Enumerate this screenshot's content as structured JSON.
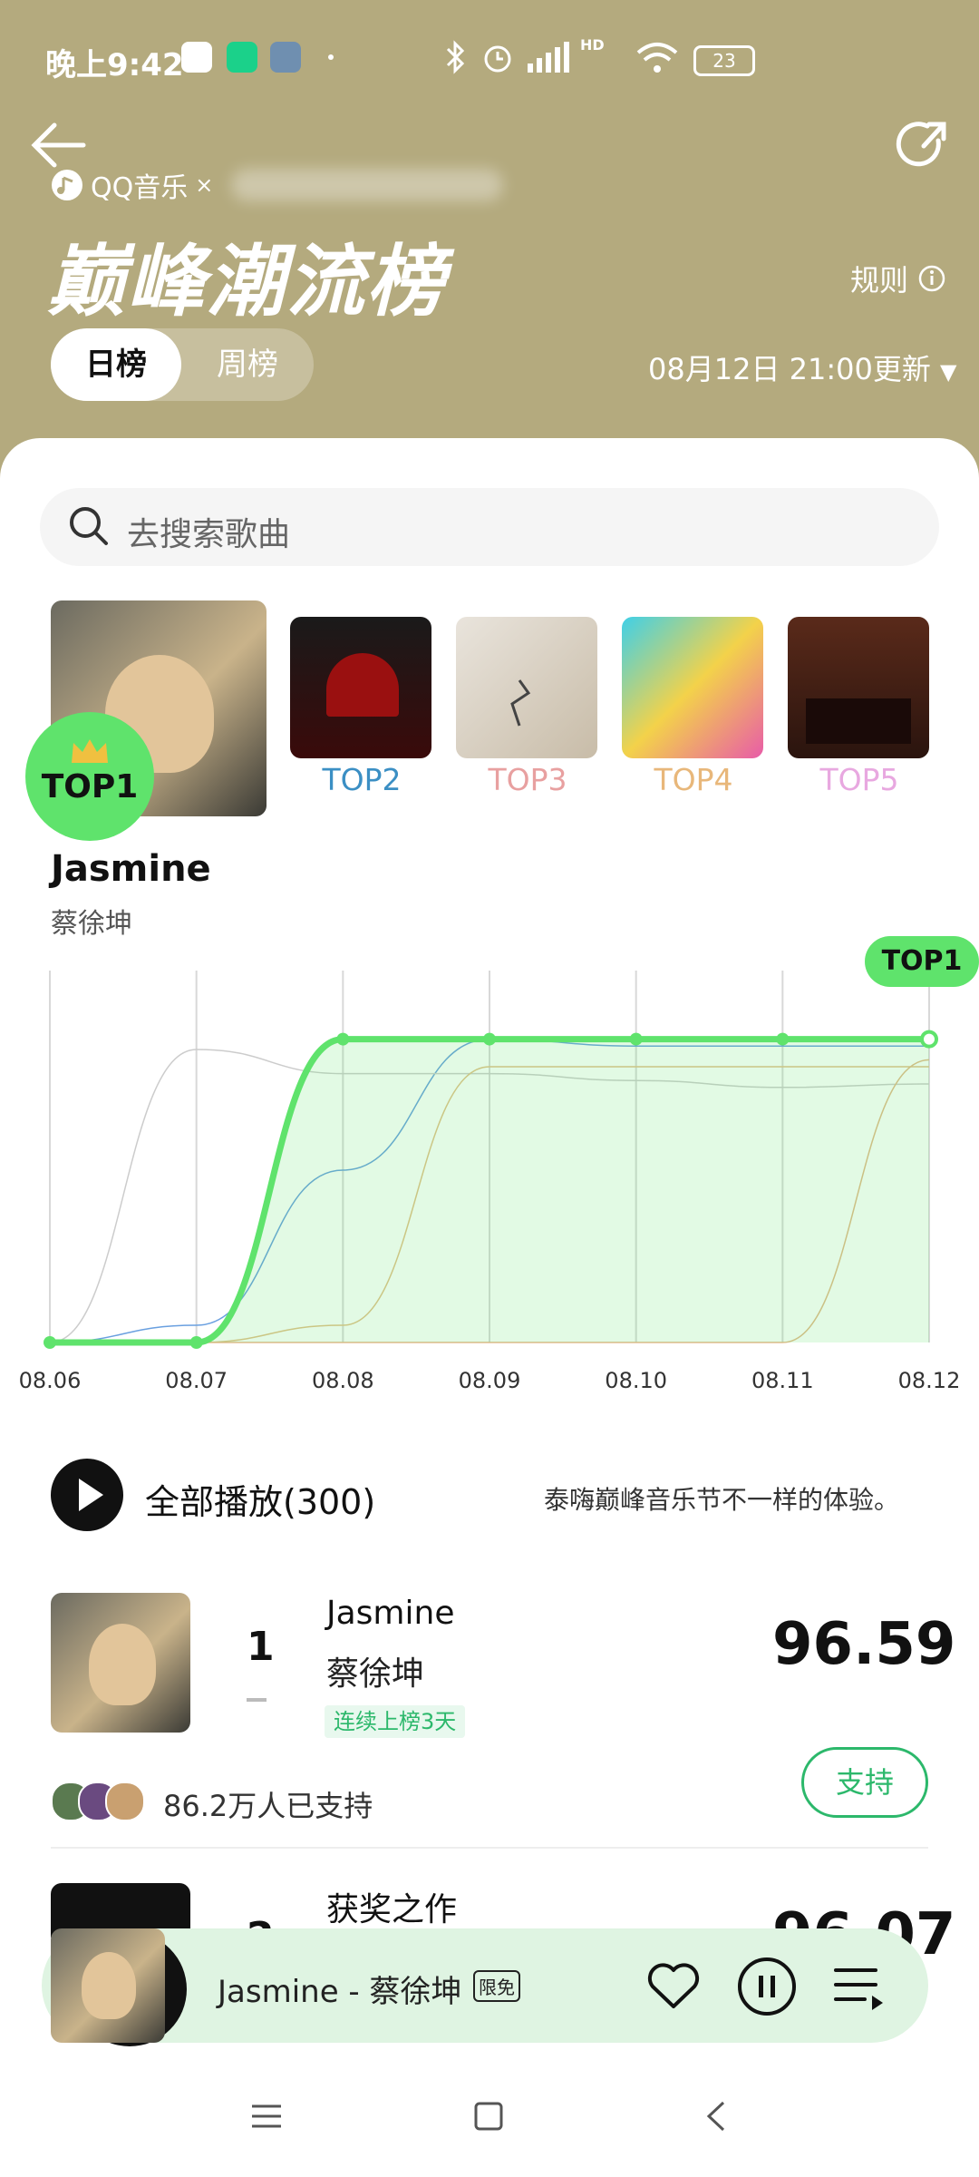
{
  "status_bar": {
    "time": "晚上9:42",
    "battery": "23",
    "network": "HD"
  },
  "header": {
    "brand": "QQ音乐",
    "brand_x": "×",
    "title": "巅峰潮流榜",
    "rules_label": "规则",
    "tabs": [
      {
        "label": "日榜",
        "active": true
      },
      {
        "label": "周榜",
        "active": false
      }
    ],
    "updated": "08月12日 21:00更新"
  },
  "search": {
    "placeholder": "去搜索歌曲"
  },
  "top_covers": [
    {
      "label": "TOP1",
      "color": "#111111"
    },
    {
      "label": "TOP2",
      "color": "#3b8fc4"
    },
    {
      "label": "TOP3",
      "color": "#e8a0a0"
    },
    {
      "label": "TOP4",
      "color": "#e8b77a"
    },
    {
      "label": "TOP5",
      "color": "#e8a8e0"
    }
  ],
  "featured": {
    "title": "Jasmine",
    "artist": "蔡徐坤"
  },
  "chart_data": {
    "type": "line",
    "x": [
      "08.06",
      "08.07",
      "08.08",
      "08.09",
      "08.10",
      "08.11",
      "08.12"
    ],
    "highlight_label": "TOP1",
    "series": [
      {
        "values": [
          0,
          0,
          0.88,
          0.88,
          0.88,
          0.88,
          0.88
        ],
        "color": "#5fe36c"
      },
      {
        "values": [
          0,
          0.05,
          0.5,
          0.88,
          0.86,
          0.86,
          0.86
        ],
        "color": "#6aa0e0"
      },
      {
        "values": [
          0,
          0.85,
          0.78,
          0.78,
          0.76,
          0.74,
          0.75
        ],
        "color": "#cccccc"
      },
      {
        "values": [
          0,
          0,
          0.05,
          0.8,
          0.8,
          0.8,
          0.8
        ],
        "color": "#e3c08a"
      },
      {
        "values": [
          0,
          0,
          0,
          0,
          0,
          0,
          0.82
        ],
        "color": "#e3b98a"
      }
    ]
  },
  "play_all": {
    "label": "全部播放(300)",
    "slogan": "泰嗨巅峰音乐节不一样的体验。"
  },
  "rows": [
    {
      "rank": "1",
      "title": "Jasmine",
      "artist": "蔡徐坤",
      "score": "96.59",
      "streak": "连续上榜3天",
      "supporters": "86.2万人已支持",
      "support_label": "支持"
    },
    {
      "rank": "2",
      "title": "获奖之作",
      "score": "96.07"
    }
  ],
  "mini_player": {
    "text": "Jasmine - 蔡徐坤",
    "badge": "限免"
  }
}
